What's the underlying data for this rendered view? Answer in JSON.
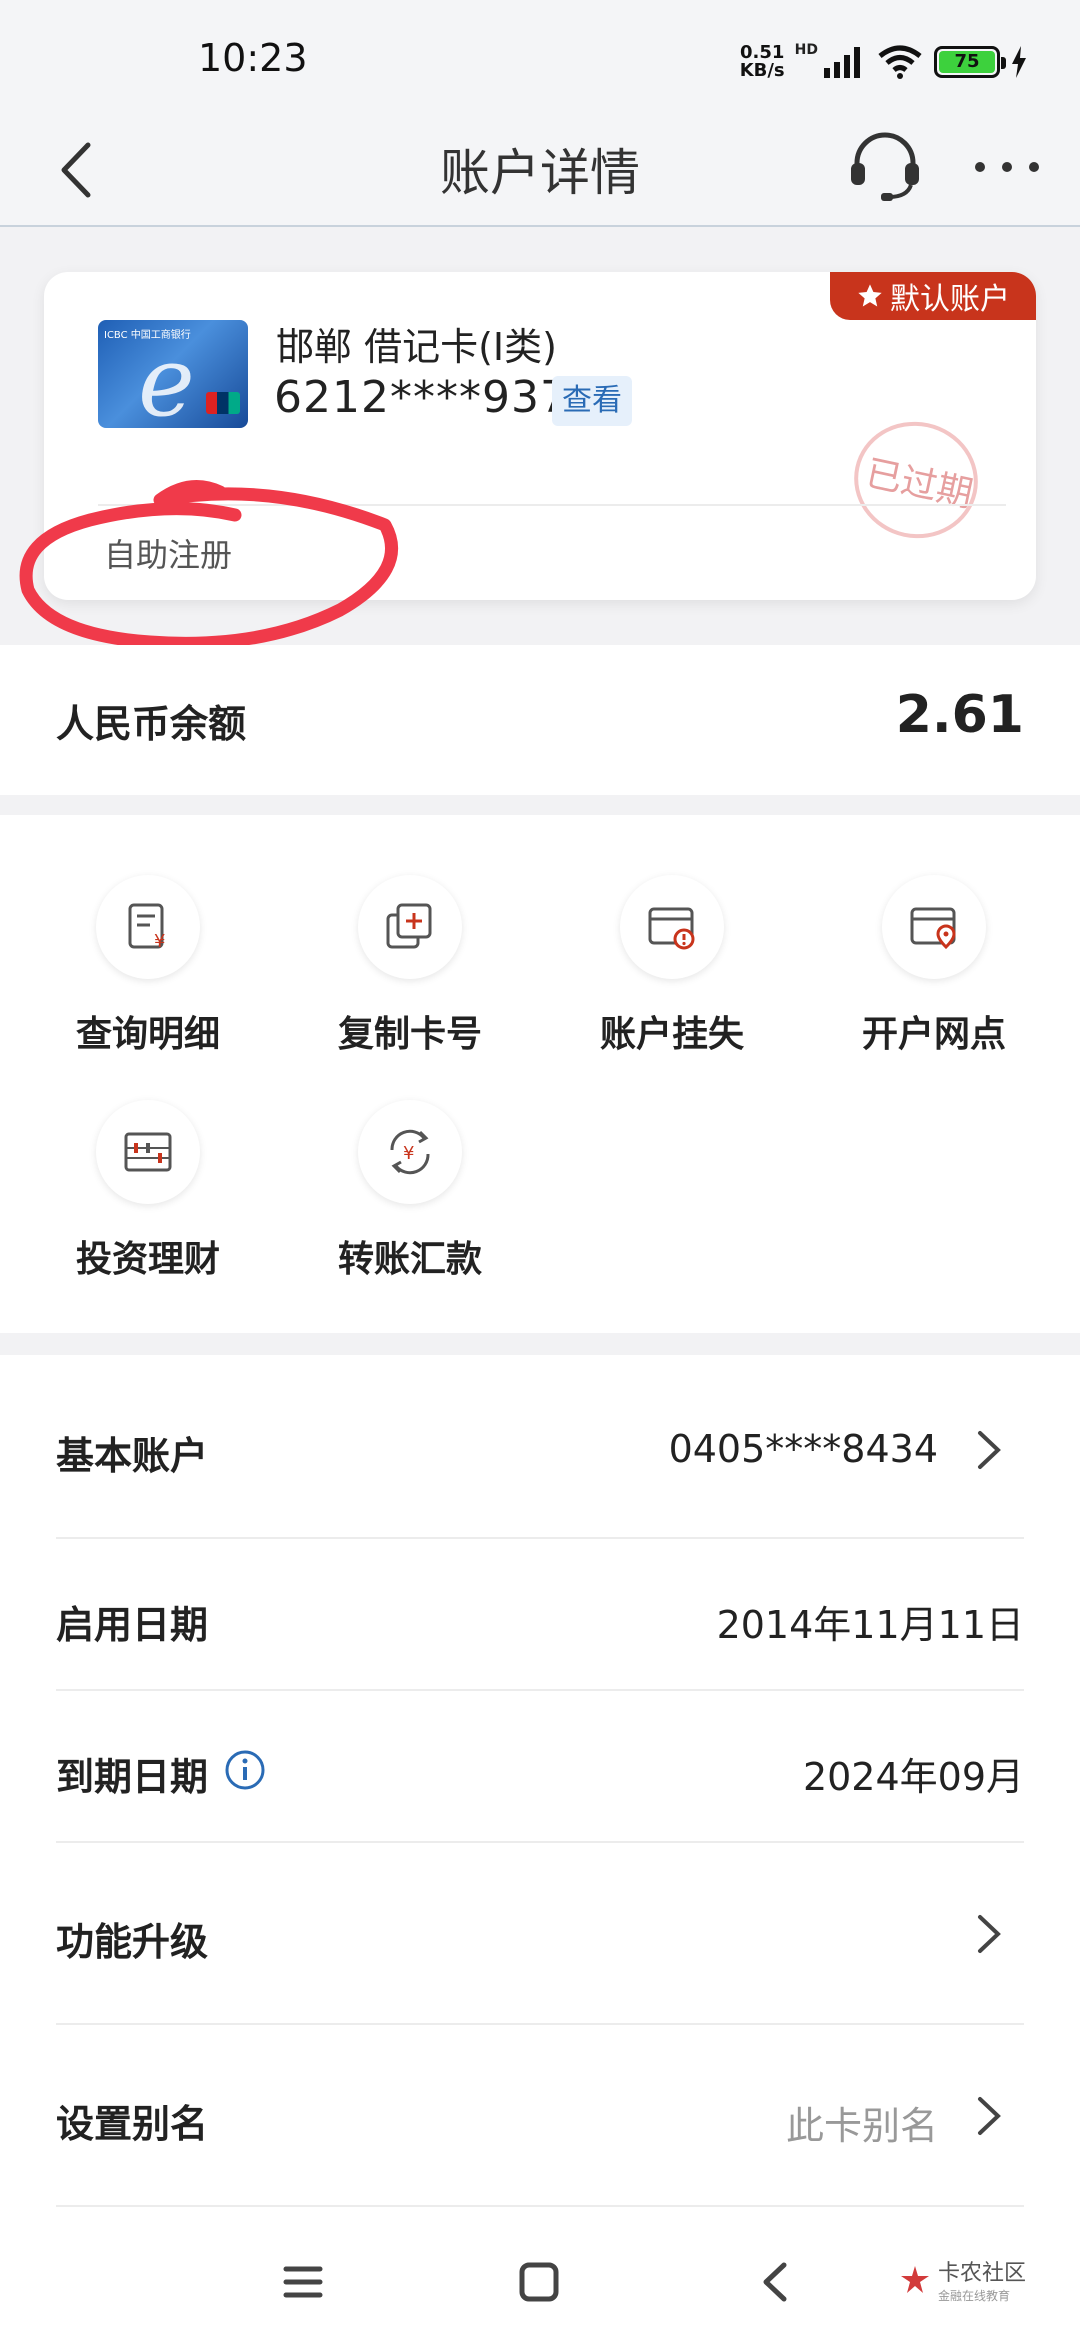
{
  "status_bar": {
    "time": "10:23",
    "net_speed_value": "0.51",
    "net_speed_unit": "KB/s",
    "signal_tag": "HD",
    "battery": "75"
  },
  "header": {
    "title": "账户详情"
  },
  "card": {
    "default_badge": "默认账户",
    "name": "邯郸 借记卡(I类)",
    "number": "6212****9377",
    "view_label": "查看",
    "stamp": "已过期",
    "register_label": "自助注册",
    "image_text": "ICBC 中国工商银行"
  },
  "balance": {
    "label": "人民币余额",
    "value": "2.61"
  },
  "actions": [
    {
      "label": "查询明细",
      "icon": "statement-icon"
    },
    {
      "label": "复制卡号",
      "icon": "copy-icon"
    },
    {
      "label": "账户挂失",
      "icon": "report-loss-icon"
    },
    {
      "label": "开户网点",
      "icon": "branch-location-icon"
    },
    {
      "label": "投资理财",
      "icon": "abacus-icon"
    },
    {
      "label": "转账汇款",
      "icon": "transfer-icon"
    }
  ],
  "details": {
    "basic_account": {
      "label": "基本账户",
      "value": "0405****8434"
    },
    "start_date": {
      "label": "启用日期",
      "value": "2014年11月11日"
    },
    "expiry_date": {
      "label": "到期日期",
      "value": "2024年09月"
    },
    "upgrade": {
      "label": "功能升级"
    },
    "alias": {
      "label": "设置别名",
      "value": "此卡别名"
    }
  },
  "watermark": {
    "title": "卡农社区",
    "subtitle": "金融在线教育"
  },
  "colors": {
    "accent_red": "#c8341c",
    "link_blue": "#2a6bb5",
    "annotation_red": "#f03a4a"
  }
}
